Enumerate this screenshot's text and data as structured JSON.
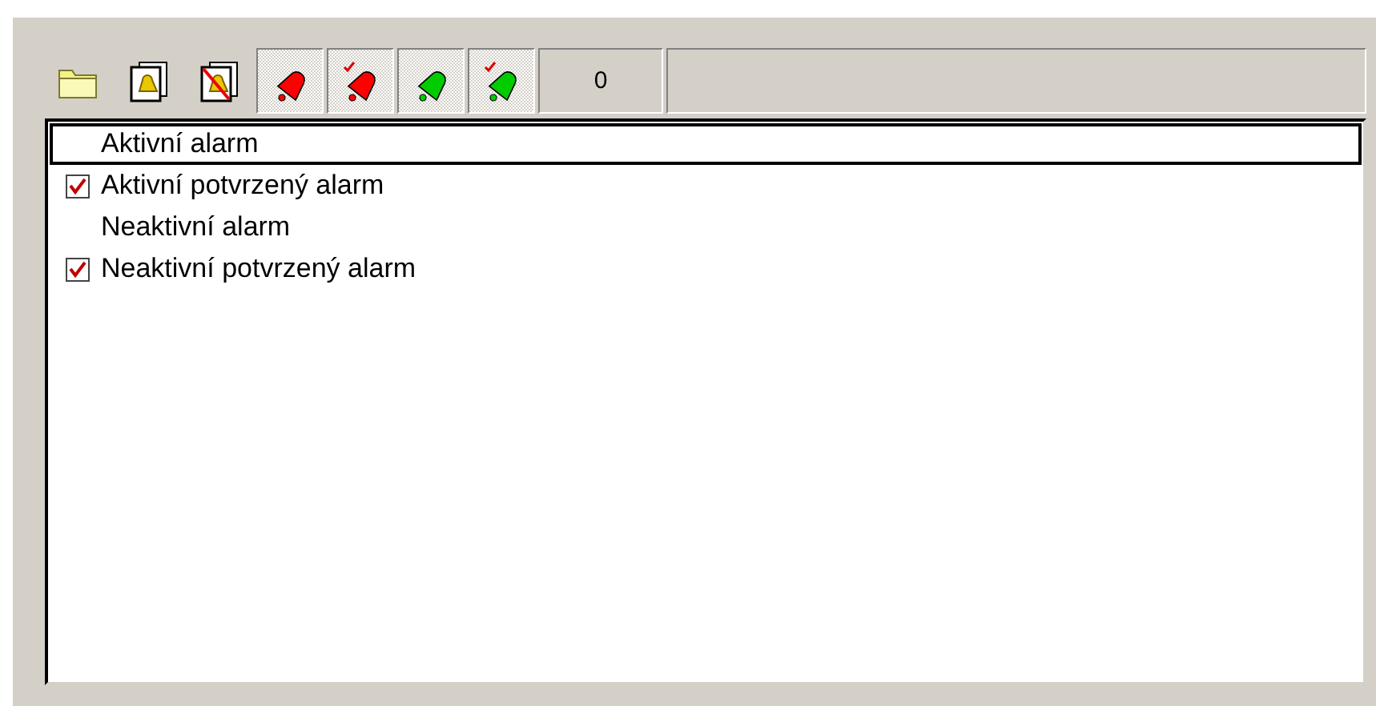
{
  "toolbar": {
    "buttons": [
      {
        "kind": "folder"
      },
      {
        "kind": "doc-bell"
      },
      {
        "kind": "doc-bell-off"
      }
    ],
    "filters": [
      {
        "color": "#ff0000",
        "acked": false,
        "on": true
      },
      {
        "color": "#ff0000",
        "acked": true,
        "on": true
      },
      {
        "color": "#00cc00",
        "acked": false,
        "on": true
      },
      {
        "color": "#00cc00",
        "acked": true,
        "on": true
      }
    ],
    "counter": "0"
  },
  "list": {
    "items": [
      {
        "label": "Aktivní alarm",
        "checked": false,
        "selected": true
      },
      {
        "label": "Aktivní potvrzený alarm",
        "checked": true,
        "selected": false
      },
      {
        "label": "Neaktivní alarm",
        "checked": false,
        "selected": false
      },
      {
        "label": "Neaktivní potvrzený alarm",
        "checked": true,
        "selected": false
      }
    ]
  }
}
